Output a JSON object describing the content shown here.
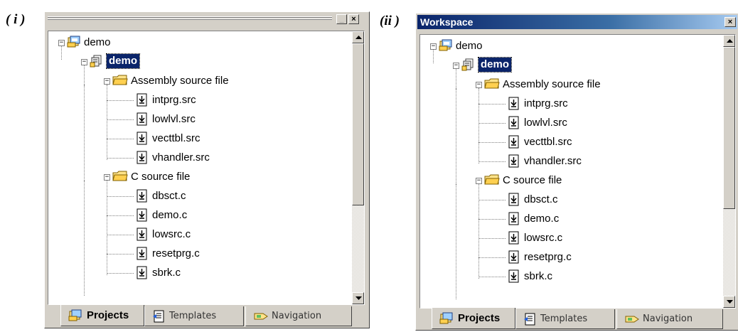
{
  "panels": [
    {
      "label": "( i )"
    },
    {
      "label": "(ii )",
      "title": "Workspace"
    }
  ],
  "window_buttons": {
    "minimize": "_",
    "close": "×"
  },
  "tree": [
    {
      "label": "demo",
      "icon": "workspace-icon",
      "level": 0,
      "expanded": true
    },
    {
      "label": "demo",
      "icon": "project-icon",
      "level": 1,
      "expanded": true,
      "selected": true
    },
    {
      "label": "Assembly source file",
      "icon": "folder-icon",
      "level": 2,
      "expanded": true
    },
    {
      "label": "intprg.src",
      "icon": "file-icon",
      "level": 3
    },
    {
      "label": "lowlvl.src",
      "icon": "file-icon",
      "level": 3
    },
    {
      "label": "vecttbl.src",
      "icon": "file-icon",
      "level": 3
    },
    {
      "label": "vhandler.src",
      "icon": "file-icon",
      "level": 3
    },
    {
      "label": "C source file",
      "icon": "folder-icon",
      "level": 2,
      "expanded": true
    },
    {
      "label": "dbsct.c",
      "icon": "file-icon",
      "level": 3
    },
    {
      "label": "demo.c",
      "icon": "file-icon",
      "level": 3
    },
    {
      "label": "lowsrc.c",
      "icon": "file-icon",
      "level": 3
    },
    {
      "label": "resetprg.c",
      "icon": "file-icon",
      "level": 3
    },
    {
      "label": "sbrk.c",
      "icon": "file-icon",
      "level": 3
    }
  ],
  "tabs": [
    {
      "label": "Projects",
      "icon": "projects-tab-icon",
      "active": true
    },
    {
      "label": "Templates",
      "icon": "templates-tab-icon",
      "active": false
    },
    {
      "label": "Navigation",
      "icon": "navigation-tab-icon",
      "active": false
    }
  ],
  "colors": {
    "selection": "#0a246a",
    "titlebar": "#0a246a",
    "face": "#d4d0c8"
  }
}
